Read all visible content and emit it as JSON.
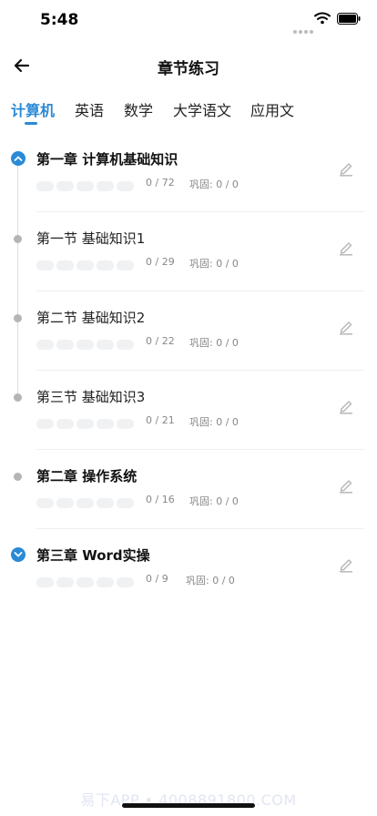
{
  "status_bar": {
    "time": "5:48"
  },
  "header": {
    "title": "章节练习"
  },
  "tabs": [
    {
      "label": "计算机",
      "active": true
    },
    {
      "label": "英语",
      "active": false
    },
    {
      "label": "数学",
      "active": false
    },
    {
      "label": "大学语文",
      "active": false
    },
    {
      "label": "应用文",
      "active": false
    }
  ],
  "chapters": [
    {
      "title": "第一章 计算机基础知识",
      "level": "chapter",
      "expanded": true,
      "progress": "0 / 72",
      "review": "巩固: 0 / 0"
    },
    {
      "title": "第一节 基础知识1",
      "level": "section",
      "progress": "0 / 29",
      "review": "巩固: 0 / 0"
    },
    {
      "title": "第二节 基础知识2",
      "level": "section",
      "progress": "0 / 22",
      "review": "巩固: 0 / 0"
    },
    {
      "title": "第三节 基础知识3",
      "level": "section",
      "progress": "0 / 21",
      "review": "巩固: 0 / 0"
    },
    {
      "title": "第二章 操作系统",
      "level": "chapter",
      "expanded": false,
      "progress": "0 / 16",
      "review": "巩固: 0 / 0"
    },
    {
      "title": "第三章 Word实操",
      "level": "chapter",
      "expanded": false,
      "collapsible": true,
      "progress": "0 / 9",
      "review": "巩固: 0 / 0"
    }
  ],
  "watermark": "易下APP • 4008891800.COM",
  "colors": {
    "accent": "#2a8ad6",
    "bullet": "#b5b5b5",
    "pill": "#f0f1f3"
  },
  "icons": {
    "back": "arrow-left-icon",
    "expand": "chevron-up-icon",
    "collapse": "chevron-down-icon",
    "edit": "pencil-icon"
  }
}
